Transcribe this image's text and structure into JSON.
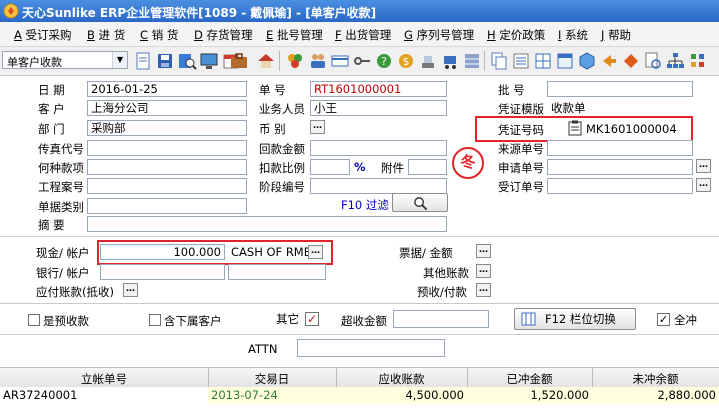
{
  "window": {
    "title": "天心Sunlike ERP企业管理软件[1089 - 戴佩瑜] - [单客户收款]"
  },
  "menu": [
    {
      "key": "A",
      "label": "受订采购"
    },
    {
      "key": "B",
      "label": "进  货"
    },
    {
      "key": "C",
      "label": "销  货"
    },
    {
      "key": "D",
      "label": "存货管理"
    },
    {
      "key": "E",
      "label": "批号管理"
    },
    {
      "key": "F",
      "label": "出货管理"
    },
    {
      "key": "G",
      "label": "序列号管理"
    },
    {
      "key": "H",
      "label": "定价政策"
    },
    {
      "key": "I",
      "label": "系统"
    },
    {
      "key": "J",
      "label": "帮助"
    }
  ],
  "toolbar": {
    "form_select_value": "单客户收款"
  },
  "form": {
    "date_label": "日    期",
    "date_value": "2016-01-25",
    "customer_label": "客    户",
    "customer_value": "上海分公司",
    "dept_label": "部    门",
    "dept_value": "采购部",
    "fax_label": "传真代号",
    "payitem_label": "何种款项",
    "project_label": "工程案号",
    "doctype_label": "单据类别",
    "summary_label": "摘    要",
    "docno_label": "单    号",
    "docno_value": "RT1601000001",
    "salesman_label": "业务人员",
    "salesman_value": "小王",
    "currency_label": "币    别",
    "refund_label": "回款金额",
    "discount_label": "扣款比例",
    "percent": "%",
    "attach_label": "附件",
    "stage_label": "阶段编号",
    "f10_label": "F10 过滤",
    "batch_label": "批    号",
    "voucher_tpl_label": "凭证模版",
    "voucher_tpl_value": "收款单",
    "voucher_no_label": "凭证号码",
    "voucher_no_value": "MK1601000004",
    "source_label": "来源单号",
    "apply_label": "申请单号",
    "order_label": "受订单号",
    "stamp_char": "冬"
  },
  "payment": {
    "cash_label": "现金/ 帐户",
    "cash_amount": "100.000",
    "cash_account": "CASH OF RMB",
    "bank_label": "银行/ 帐户",
    "payable_label": "应付账款(抵收)",
    "bill_label": "票据/ 金额",
    "other_label": "其他账款",
    "prepaid_label": "预收/付款"
  },
  "options": {
    "is_prepaid_label": "是预收款",
    "is_prepaid_checked": false,
    "include_sub_label": "含下属客户",
    "include_sub_checked": false,
    "other_label": "其它",
    "other_checked": true,
    "over_amount_label": "超收金额",
    "f12_label": "F12 栏位切换",
    "select_all_label": "全冲",
    "select_all_checked": true,
    "check_mark": "✓"
  },
  "attn": {
    "label": "ATTN",
    "value": ""
  },
  "grid": {
    "columns": [
      "立帐单号",
      "交易日",
      "应收账款",
      "已冲金额",
      "未冲余额"
    ],
    "rows": [
      [
        "AR37240001",
        "2013-07-24",
        "4,500.000",
        "1,520.000",
        "2,880.000"
      ]
    ]
  },
  "colors": {
    "accent_red": "#e0262c",
    "title_blue": "#2a68c8",
    "date_green": "#2e7d32",
    "blue_text": "#0000c0"
  }
}
